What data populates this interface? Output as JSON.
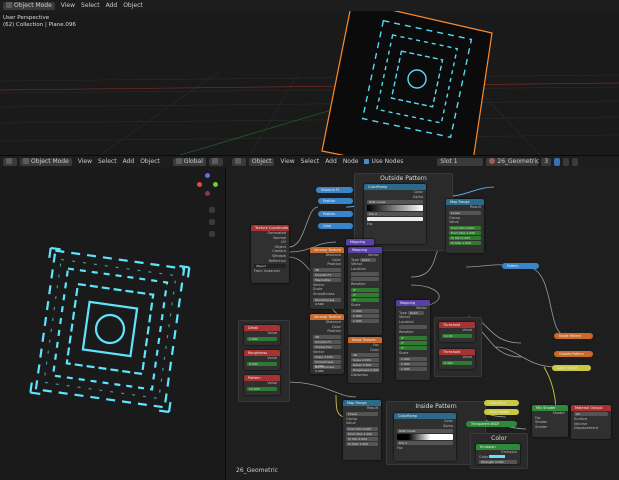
{
  "top_header": {
    "mode": "Object Mode",
    "menus": [
      "View",
      "Select",
      "Add",
      "Object"
    ]
  },
  "top_viewport": {
    "perspective": "User Perspective",
    "collection": "(62) Collection | Plane.096"
  },
  "node_header": {
    "mode": "Object Mode",
    "menus": [
      "View",
      "Select",
      "Add",
      "Object"
    ],
    "orientation": "Global",
    "editor_type": "Object",
    "node_menus": [
      "View",
      "Select",
      "Add",
      "Node"
    ],
    "use_nodes": "Use Nodes",
    "slot": "Slot 1",
    "material": "26_Geometric",
    "users": "3"
  },
  "node_editor": {
    "frame_label": "26_Geometric",
    "groups": {
      "outside": "Outside Pattern",
      "inside": "Inside Pattern",
      "color": "Color"
    },
    "nodes": {
      "texcoord": {
        "title": "Texture Coordinate",
        "outputs": [
          "Generated",
          "Normal",
          "UV",
          "Object",
          "Camera",
          "Window",
          "Reflection"
        ],
        "object_label": "Object",
        "instancer": "From Instancer"
      },
      "detail": {
        "title": "Detail",
        "field": "Value",
        "value": "1.000"
      },
      "roughness": {
        "title": "Roughness",
        "field": "Value",
        "value": "0.500"
      },
      "pattern": {
        "title": "Pattern",
        "field": "Value",
        "value": "14.000"
      },
      "voronoi1": {
        "title": "Voronoi Texture",
        "outputs": [
          "Distance",
          "Color",
          "Position"
        ],
        "rows": [
          "3D",
          "Smooth F1",
          "Manhattan",
          "Vector",
          "Scale",
          "Smoothness"
        ],
        "randomness": "Randomness 0.500"
      },
      "voronoi2": {
        "title": "Voronoi Texture",
        "outputs": [
          "Distance",
          "Color",
          "Position"
        ],
        "rows": [
          "3D",
          "Smooth F1",
          "Chebychev",
          "Vector"
        ],
        "scale": "Scale 4.500",
        "smoothness": "Smoothness 0.000",
        "randomness": "Randomness 0.000"
      },
      "mapping1": {
        "title": "Mapping",
        "output": "Vector",
        "type_label": "Type",
        "type": "Point",
        "rows": [
          "Vector",
          "Location",
          "Rotation",
          "Scale"
        ],
        "scale_vals": [
          "1.000",
          "1.000",
          "1.000"
        ],
        "g_vals": [
          "0°",
          "0°",
          "0°"
        ]
      },
      "noise": {
        "title": "Noise Texture",
        "outputs": [
          "Fac",
          "Color"
        ],
        "rows": [
          "3D"
        ],
        "scale": "Scale 2.000",
        "detail": "Detail 0.000",
        "roughness": "Roughness 0.000",
        "distortion": "Distortion"
      },
      "mapping2": {
        "title": "Mapping",
        "output": "Vector",
        "type_label": "Type",
        "type": "Point",
        "rows": [
          "Vector",
          "Location",
          "Rotation",
          "Scale"
        ],
        "scale_vals": [
          "1.000",
          "1.000",
          "1.000"
        ],
        "g_vals": [
          "0°",
          "0°",
          "0°"
        ]
      },
      "mapping_top": {
        "title": "Mapping"
      },
      "colorramp_top": {
        "title": "ColorRamp",
        "outputs": [
          "Color",
          "Alpha"
        ],
        "mode": "RGB",
        "interp": "Linear",
        "pos": "Pos",
        "pos_val": "0",
        "fac": "Fac"
      },
      "maprange_top": {
        "title": "Map Range",
        "output": "Result",
        "interp": "Linear",
        "clamp": "Clamp",
        "value": "Value",
        "fields": [
          "From Min 0.000",
          "From Max 1.000",
          "To Min 0.000",
          "To Max 1.000"
        ]
      },
      "threshold1": {
        "title": "Threshold",
        "field": "Value",
        "value": "0.130"
      },
      "threshold2": {
        "title": "Threshold",
        "field": "Value",
        "value": "0.400"
      },
      "maprange_bot": {
        "title": "Map Range",
        "output": "Result",
        "interp": "Linear",
        "clamp": "Clamp",
        "value": "Value",
        "fields": [
          "From Min 0.000",
          "From Max 1.000",
          "To Min 0.000",
          "To Max 1.000"
        ]
      },
      "colorramp_bot": {
        "title": "ColorRamp",
        "outputs": [
          "Color",
          "Alpha"
        ],
        "mode": "RGB",
        "interp": "Linear",
        "pos": "Pos",
        "pos_val": "1",
        "fac": "Fac"
      },
      "mix_shader": {
        "title": "Mix Shader",
        "output": "Shader",
        "inputs": [
          "Fac",
          "Shader",
          "Shader"
        ]
      },
      "material_output": {
        "title": "Material Output",
        "target": "All",
        "inputs": [
          "Surface",
          "Volume",
          "Displacement"
        ]
      },
      "emission": {
        "title": "Emission",
        "output": "Emission",
        "inputs": [
          "Color",
          "Strength 4.000"
        ]
      }
    },
    "reroutes": {
      "r1": "Distance F1",
      "r2": "Position",
      "r3": "Position",
      "r4": "Color",
      "r5": "Pattern",
      "r6": "Inside Pattern",
      "r7": "Outside Pattern",
      "r8": "Color Output",
      "r9": "Color Burn",
      "r10": "Color Dodge",
      "r11": "Transparent BSDF"
    }
  },
  "colors": {
    "glow": "#5fe4ff",
    "selection": "#ff8a2a",
    "header_bg": "#1d1d1d",
    "node_header_input": "#a83232",
    "node_header_texture": "#c76a2a",
    "node_header_vector": "#5b3fa8",
    "node_header_converter": "#2a6a8a",
    "node_header_shader": "#2d8a3a"
  }
}
